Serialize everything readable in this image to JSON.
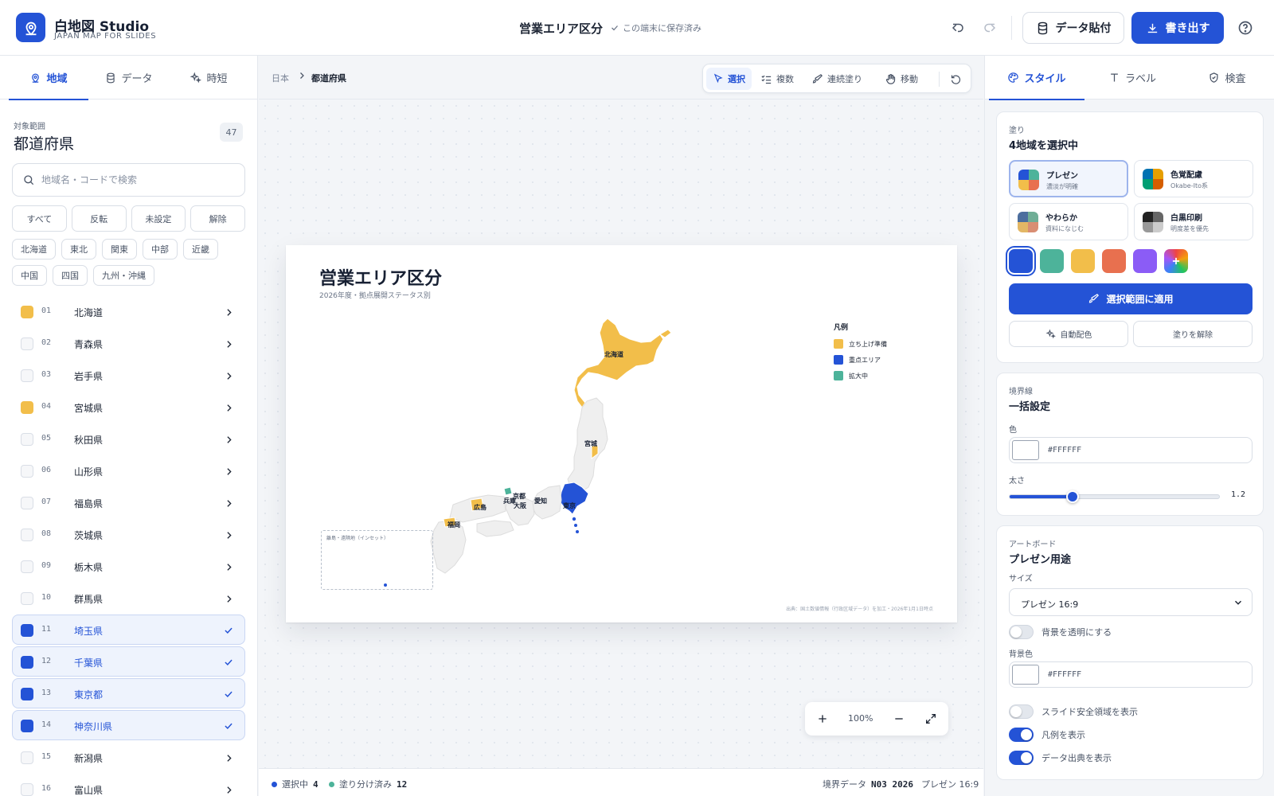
{
  "app": {
    "name": "白地図 Studio",
    "subtitle": "JAPAN MAP FOR SLIDES",
    "document_title": "営業エリア区分",
    "save_status": "この端末に保存済み",
    "paste_label": "データ貼付",
    "export_label": "書き出す"
  },
  "left_tabs": [
    {
      "label": "地域",
      "icon": "map-pin-icon",
      "active": true
    },
    {
      "label": "データ",
      "icon": "database-icon",
      "active": false
    },
    {
      "label": "時短",
      "icon": "sparkles-icon",
      "active": false
    }
  ],
  "scope": {
    "label": "対象範囲",
    "value": "都道府県",
    "count": "47",
    "search_placeholder": "地域名・コードで検索"
  },
  "filters": [
    "すべて",
    "反転",
    "未設定",
    "解除"
  ],
  "regions": [
    "北海道",
    "東北",
    "関東",
    "中部",
    "近畿",
    "中国",
    "四国",
    "九州・沖縄"
  ],
  "prefectures": [
    {
      "code": "01",
      "name": "北海道",
      "color": "#F2BE4A",
      "selected": false
    },
    {
      "code": "02",
      "name": "青森県",
      "color": "",
      "selected": false
    },
    {
      "code": "03",
      "name": "岩手県",
      "color": "",
      "selected": false
    },
    {
      "code": "04",
      "name": "宮城県",
      "color": "#F2BE4A",
      "selected": false
    },
    {
      "code": "05",
      "name": "秋田県",
      "color": "",
      "selected": false
    },
    {
      "code": "06",
      "name": "山形県",
      "color": "",
      "selected": false
    },
    {
      "code": "07",
      "name": "福島県",
      "color": "",
      "selected": false
    },
    {
      "code": "08",
      "name": "茨城県",
      "color": "",
      "selected": false
    },
    {
      "code": "09",
      "name": "栃木県",
      "color": "",
      "selected": false
    },
    {
      "code": "10",
      "name": "群馬県",
      "color": "",
      "selected": false
    },
    {
      "code": "11",
      "name": "埼玉県",
      "color": "#2453D6",
      "selected": true
    },
    {
      "code": "12",
      "name": "千葉県",
      "color": "#2453D6",
      "selected": true
    },
    {
      "code": "13",
      "name": "東京都",
      "color": "#2453D6",
      "selected": true
    },
    {
      "code": "14",
      "name": "神奈川県",
      "color": "#2453D6",
      "selected": true
    },
    {
      "code": "15",
      "name": "新潟県",
      "color": "",
      "selected": false
    },
    {
      "code": "16",
      "name": "富山県",
      "color": "",
      "selected": false
    }
  ],
  "breadcrumb": {
    "root": "日本",
    "current": "都道府県"
  },
  "tools": [
    {
      "label": "選択",
      "icon": "cursor-icon",
      "active": true
    },
    {
      "label": "複数",
      "icon": "checklist-icon",
      "active": false
    },
    {
      "label": "連続塗り",
      "icon": "brush-icon",
      "active": false
    },
    {
      "label": "移動",
      "icon": "hand-icon",
      "active": false
    }
  ],
  "artboard": {
    "title": "営業エリア区分",
    "subtitle": "2026年度・拠点展開ステータス別",
    "legend_title": "凡例",
    "legend": [
      {
        "label": "立ち上げ準備",
        "color": "#F2BE4A"
      },
      {
        "label": "重点エリア",
        "color": "#2453D6"
      },
      {
        "label": "拡大中",
        "color": "#4DB39A"
      }
    ],
    "inset_label": "離島・遠隔地（インセット）",
    "source": "出典：国土数値情報（行政区域データ）を加工・2026年1月1日時点",
    "map_labels": {
      "hokkaido": "北海道",
      "miyagi": "宮城",
      "tokyo": "東京",
      "aichi": "愛知",
      "kyoto": "京都",
      "osaka": "大阪",
      "hyogo": "兵庫",
      "hiroshima": "広島",
      "fukuoka": "福岡"
    }
  },
  "zoom": {
    "value": "100%"
  },
  "status": {
    "selected_label": "選択中",
    "selected_count": "4",
    "painted_label": "塗り分け済み",
    "painted_count": "12",
    "boundary_label": "境界データ",
    "boundary_value": "N03 2026",
    "format": "プレゼン 16:9"
  },
  "right_tabs": [
    {
      "label": "スタイル",
      "icon": "palette-icon",
      "active": true
    },
    {
      "label": "ラベル",
      "icon": "text-icon",
      "active": false
    },
    {
      "label": "検査",
      "icon": "shield-check-icon",
      "active": false
    }
  ],
  "fill": {
    "eyebrow": "塗り",
    "title": "4地域を選択中",
    "palettes": [
      {
        "name": "プレゼン",
        "desc": "濃淡が明確",
        "colors": [
          "#2453D6",
          "#4DB39A",
          "#F2BE4A",
          "#E8704F"
        ],
        "active": true
      },
      {
        "name": "色覚配慮",
        "desc": "Okabe-Ito系",
        "colors": [
          "#0072B2",
          "#E69F00",
          "#009E73",
          "#D55E00"
        ],
        "active": false
      },
      {
        "name": "やわらか",
        "desc": "資料になじむ",
        "colors": [
          "#4C6E9E",
          "#6FAE96",
          "#E3B765",
          "#D98E73"
        ],
        "active": false
      },
      {
        "name": "白黒印刷",
        "desc": "明度差を優先",
        "colors": [
          "#222222",
          "#666666",
          "#999999",
          "#CCCCCC"
        ],
        "active": false
      }
    ],
    "swatches": [
      "#2453D6",
      "#4DB39A",
      "#F2BE4A",
      "#E8704F",
      "#8B5CF6"
    ],
    "apply_label": "選択範囲に適用",
    "auto_label": "自動配色",
    "clear_label": "塗りを解除"
  },
  "border": {
    "eyebrow": "境界線",
    "title": "一括設定",
    "color_label": "色",
    "color_value": "#FFFFFF",
    "width_label": "太さ",
    "width_value": "1.2",
    "width_fraction": 0.3
  },
  "artboard_settings": {
    "eyebrow": "アートボード",
    "title": "プレゼン用途",
    "size_label": "サイズ",
    "size_value": "プレゼン 16:9",
    "transparent_label": "背景を透明にする",
    "transparent_on": false,
    "bg_label": "背景色",
    "bg_value": "#FFFFFF",
    "safe_area_label": "スライド安全領域を表示",
    "safe_area_on": false,
    "legend_label": "凡例を表示",
    "legend_on": true,
    "source_label": "データ出典を表示",
    "source_on": true
  }
}
